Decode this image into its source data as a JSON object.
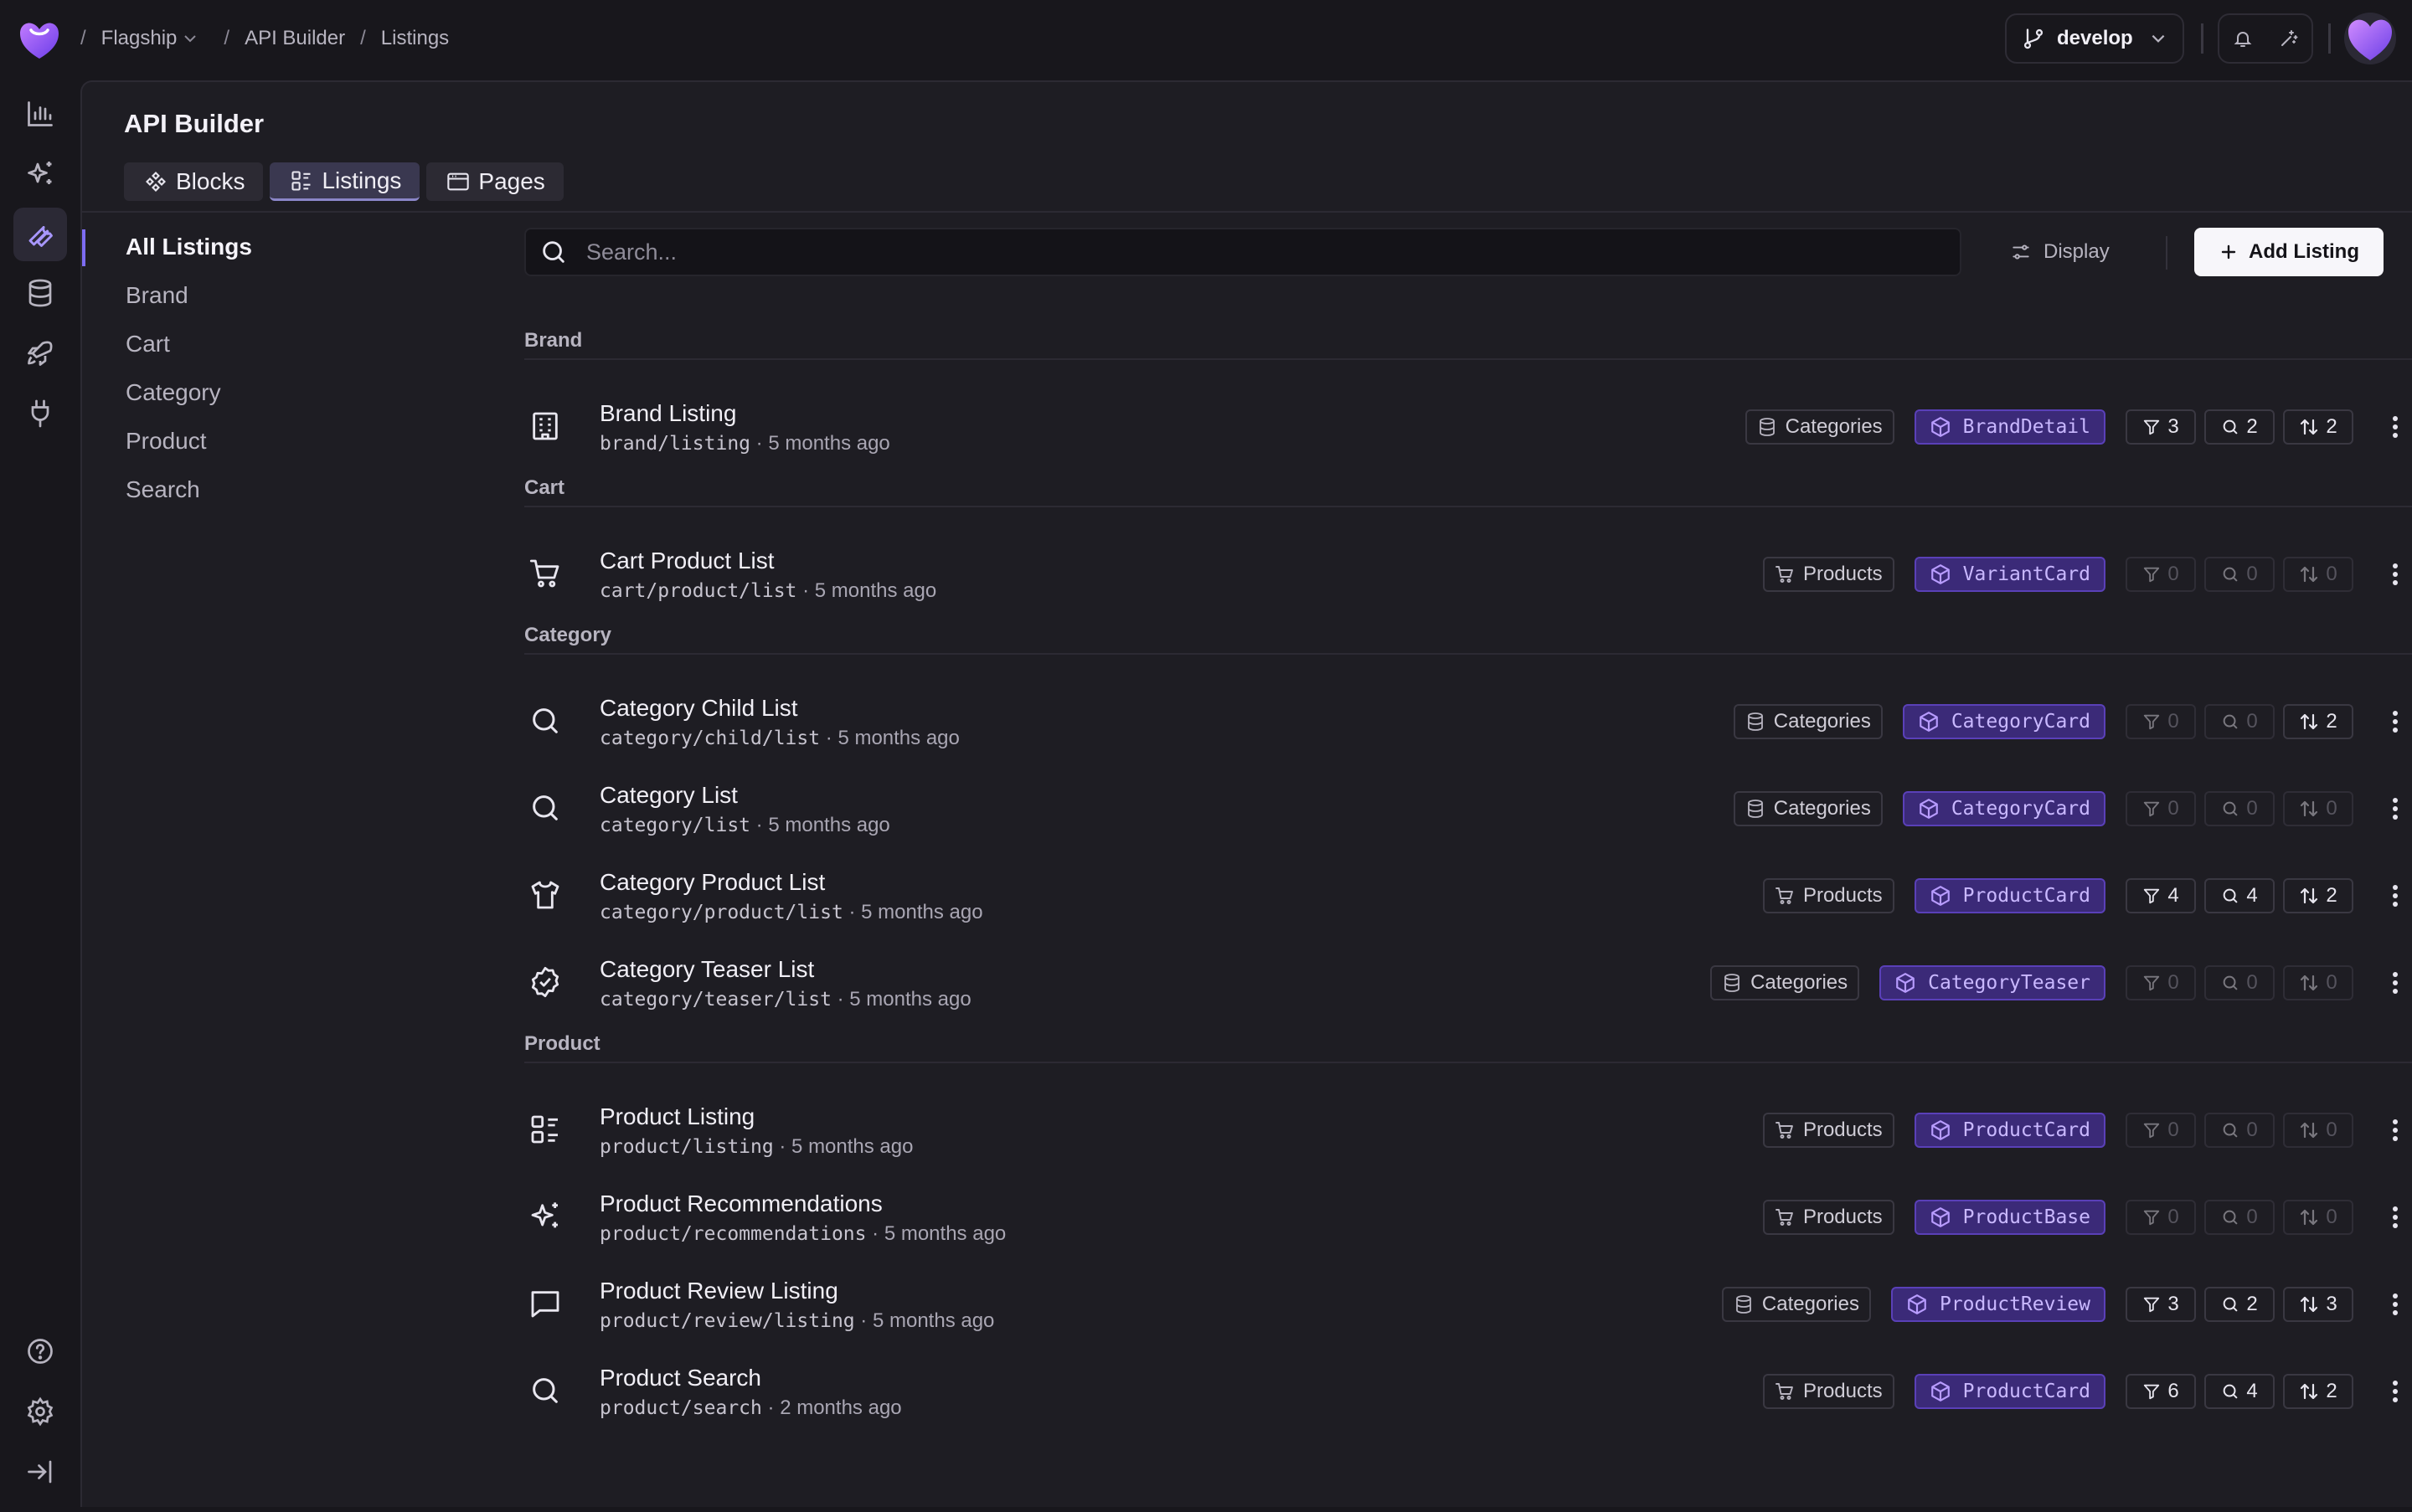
{
  "breadcrumb": {
    "org": "Flagship",
    "section": "API Builder",
    "page": "Listings",
    "sep": "/"
  },
  "branch": {
    "name": "develop"
  },
  "panel": {
    "title": "API Builder"
  },
  "tabs": [
    {
      "label": "Blocks",
      "icon": "blocks-icon"
    },
    {
      "label": "Listings",
      "icon": "listings-icon",
      "active": true
    },
    {
      "label": "Pages",
      "icon": "pages-icon"
    }
  ],
  "sidenav": [
    {
      "label": "All Listings",
      "active": true
    },
    {
      "label": "Brand"
    },
    {
      "label": "Cart"
    },
    {
      "label": "Category"
    },
    {
      "label": "Product"
    },
    {
      "label": "Search"
    }
  ],
  "search": {
    "placeholder": "Search..."
  },
  "toolbar": {
    "display_label": "Display",
    "add_label": "Add Listing"
  },
  "groups": [
    {
      "name": "Brand",
      "rows": [
        {
          "title": "Brand Listing",
          "path": "brand/listing",
          "time": "5 months ago",
          "icon": "building-icon",
          "source": "Categories",
          "source_icon": "database-icon",
          "block": "BrandDetail",
          "filters": "3",
          "search": "2",
          "sort": "2"
        }
      ]
    },
    {
      "name": "Cart",
      "rows": [
        {
          "title": "Cart Product List",
          "path": "cart/product/list",
          "time": "5 months ago",
          "icon": "cart-icon",
          "source": "Products",
          "source_icon": "cart-icon",
          "block": "VariantCard",
          "filters": "0",
          "search": "0",
          "sort": "0"
        }
      ]
    },
    {
      "name": "Category",
      "rows": [
        {
          "title": "Category Child List",
          "path": "category/child/list",
          "time": "5 months ago",
          "icon": "search-icon",
          "source": "Categories",
          "source_icon": "database-icon",
          "block": "CategoryCard",
          "filters": "0",
          "search": "0",
          "sort": "2"
        },
        {
          "title": "Category List",
          "path": "category/list",
          "time": "5 months ago",
          "icon": "search-icon",
          "source": "Categories",
          "source_icon": "database-icon",
          "block": "CategoryCard",
          "filters": "0",
          "search": "0",
          "sort": "0"
        },
        {
          "title": "Category Product List",
          "path": "category/product/list",
          "time": "5 months ago",
          "icon": "shirt-icon",
          "source": "Products",
          "source_icon": "cart-icon",
          "block": "ProductCard",
          "filters": "4",
          "search": "4",
          "sort": "2"
        },
        {
          "title": "Category Teaser List",
          "path": "category/teaser/list",
          "time": "5 months ago",
          "icon": "badge-check-icon",
          "source": "Categories",
          "source_icon": "database-icon",
          "block": "CategoryTeaser",
          "filters": "0",
          "search": "0",
          "sort": "0"
        }
      ]
    },
    {
      "name": "Product",
      "rows": [
        {
          "title": "Product Listing",
          "path": "product/listing",
          "time": "5 months ago",
          "icon": "list-icon",
          "source": "Products",
          "source_icon": "cart-icon",
          "block": "ProductCard",
          "filters": "0",
          "search": "0",
          "sort": "0"
        },
        {
          "title": "Product Recommendations",
          "path": "product/recommendations",
          "time": "5 months ago",
          "icon": "sparkles-icon",
          "source": "Products",
          "source_icon": "cart-icon",
          "block": "ProductBase",
          "filters": "0",
          "search": "0",
          "sort": "0"
        },
        {
          "title": "Product Review Listing",
          "path": "product/review/listing",
          "time": "5 months ago",
          "icon": "message-icon",
          "source": "Categories",
          "source_icon": "database-icon",
          "block": "ProductReview",
          "filters": "3",
          "search": "2",
          "sort": "3"
        },
        {
          "title": "Product Search",
          "path": "product/search",
          "time": "2 months ago",
          "icon": "search-icon",
          "source": "Products",
          "source_icon": "cart-icon",
          "block": "ProductCard",
          "filters": "6",
          "search": "4",
          "sort": "2"
        }
      ]
    }
  ],
  "colors": {
    "accent": "#7d6cf2",
    "block_bg": "#3b2a78",
    "block_text": "#c9b8ff",
    "background": "#18171c"
  }
}
